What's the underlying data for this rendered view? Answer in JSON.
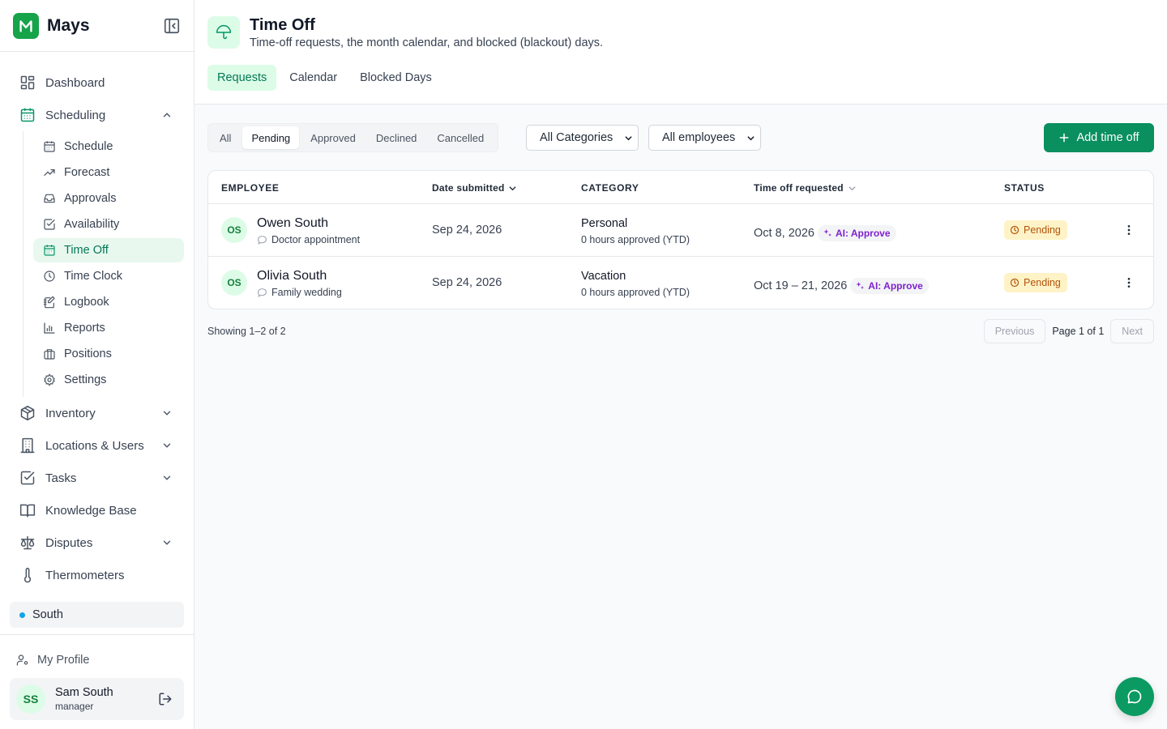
{
  "brand": {
    "name": "Mays"
  },
  "nav": {
    "dashboard": "Dashboard",
    "scheduling": "Scheduling",
    "scheduling_items": [
      "Schedule",
      "Forecast",
      "Approvals",
      "Availability",
      "Time Off",
      "Time Clock",
      "Logbook",
      "Reports",
      "Positions",
      "Settings"
    ],
    "inventory": "Inventory",
    "locations_users": "Locations & Users",
    "tasks": "Tasks",
    "knowledge_base": "Knowledge Base",
    "disputes": "Disputes",
    "thermometers": "Thermometers"
  },
  "location": {
    "name": "South",
    "dot_color": "#0ea5e9"
  },
  "profile": {
    "my_profile": "My Profile",
    "initials": "SS",
    "name": "Sam South",
    "role": "manager"
  },
  "header": {
    "title": "Time Off",
    "subtitle": "Time-off requests, the month calendar, and blocked (blackout) days.",
    "icon": "umbrella-icon",
    "tabs": [
      "Requests",
      "Calendar",
      "Blocked Days"
    ],
    "active_tab": "Requests"
  },
  "filters": {
    "status_segments": [
      "All",
      "Pending",
      "Approved",
      "Declined",
      "Cancelled"
    ],
    "active_segment": "Pending",
    "category_select": "All Categories",
    "employee_select": "All employees",
    "add_button": "Add time off"
  },
  "table": {
    "columns": {
      "employee": "EMPLOYEE",
      "date_submitted": "Date submitted",
      "category": "CATEGORY",
      "time_off_requested": "Time off requested",
      "status": "STATUS"
    },
    "rows": [
      {
        "initials": "OS",
        "name": "Owen South",
        "note": "Doctor appointment",
        "date_submitted": "Sep 24, 2026",
        "category": "Personal",
        "category_detail": "0 hours approved (YTD)",
        "requested": "Oct 8, 2026",
        "ai_badge": "AI: Approve",
        "status": "Pending"
      },
      {
        "initials": "OS",
        "name": "Olivia South",
        "note": "Family wedding",
        "date_submitted": "Sep 24, 2026",
        "category": "Vacation",
        "category_detail": "0 hours approved (YTD)",
        "requested": "Oct 19 – 21, 2026",
        "ai_badge": "AI: Approve",
        "status": "Pending"
      }
    ]
  },
  "pagination": {
    "showing": "Showing 1–2 of 2",
    "previous": "Previous",
    "page_label": "Page 1 of 1",
    "next": "Next"
  },
  "colors": {
    "accent": "#0a8f5f",
    "accent_light": "#dcfce7",
    "pending_bg": "#fef3c7",
    "pending_text": "#b45309",
    "ai_text": "#7e22ce"
  }
}
